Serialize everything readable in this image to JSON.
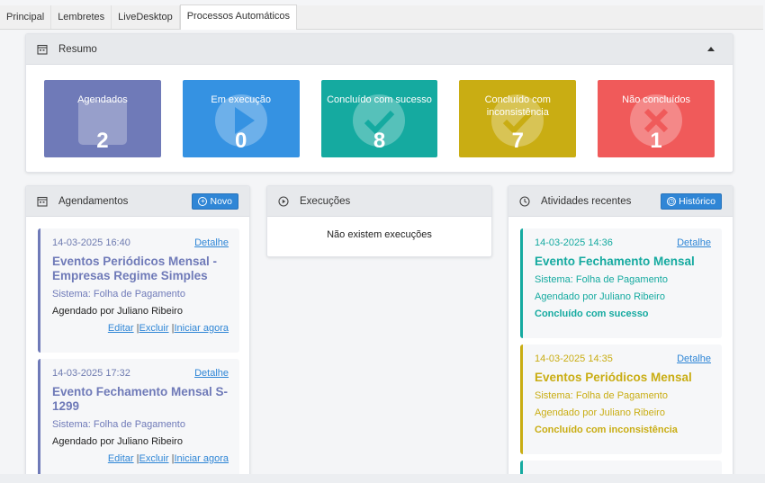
{
  "tabs": [
    {
      "label": "Principal",
      "active": false
    },
    {
      "label": "Lembretes",
      "active": false
    },
    {
      "label": "LiveDesktop",
      "active": false
    },
    {
      "label": "Processos Automáticos",
      "active": true
    }
  ],
  "resumo": {
    "title": "Resumo",
    "tiles": [
      {
        "label": "Agendados",
        "count": "2",
        "color": "#6f7ab8",
        "icon": "calendar-icon"
      },
      {
        "label": "Em execução",
        "count": "0",
        "color": "#3592e2",
        "icon": "play-icon"
      },
      {
        "label": "Concluído com sucesso",
        "count": "8",
        "color": "#15aaa0",
        "icon": "check-icon"
      },
      {
        "label": "Concluído com inconsistência",
        "count": "7",
        "color": "#c9ad13",
        "icon": "check-icon"
      },
      {
        "label": "Não concluídos",
        "count": "1",
        "color": "#f05a5a",
        "icon": "x-icon"
      }
    ]
  },
  "agendamentos": {
    "title": "Agendamentos",
    "new_label": "Novo",
    "items": [
      {
        "datetime": "14-03-2025 16:40",
        "detail": "Detalhe",
        "title": "Eventos Periódicos Mensal - Empresas Regime Simples",
        "sistema": "Sistema: Folha de Pagamento",
        "agendado": "Agendado por Juliano Ribeiro",
        "edit": "Editar",
        "delete": "Excluir",
        "start": "Iniciar agora"
      },
      {
        "datetime": "14-03-2025 17:32",
        "detail": "Detalhe",
        "title": "Evento Fechamento Mensal S-1299",
        "sistema": "Sistema: Folha de Pagamento",
        "agendado": "Agendado por Juliano Ribeiro",
        "edit": "Editar",
        "delete": "Excluir",
        "start": "Iniciar agora"
      }
    ],
    "accent": "#6f7ab8"
  },
  "execucoes": {
    "title": "Execuções",
    "empty_text": "Não existem execuções"
  },
  "atividades": {
    "title": "Atividades recentes",
    "history_label": "Histórico",
    "items": [
      {
        "datetime": "14-03-2025 14:36",
        "detail": "Detalhe",
        "title": "Evento Fechamento Mensal",
        "sistema": "Sistema: Folha de Pagamento",
        "agendado": "Agendado por Juliano Ribeiro",
        "status": "Concluído com sucesso",
        "color": "#15aaa0"
      },
      {
        "datetime": "14-03-2025 14:35",
        "detail": "Detalhe",
        "title": "Eventos Periódicos Mensal",
        "sistema": "Sistema: Folha de Pagamento",
        "agendado": "Agendado por Juliano Ribeiro",
        "status": "Concluído com inconsistência",
        "color": "#c9ad13"
      }
    ]
  }
}
